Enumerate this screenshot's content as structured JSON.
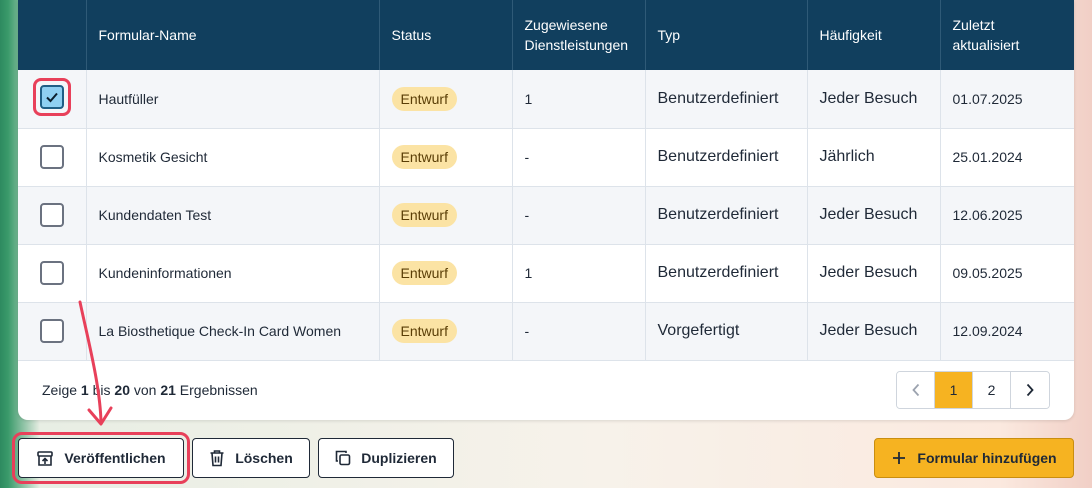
{
  "table": {
    "headers": [
      "",
      "Formular-Name",
      "Status",
      "Zugewiesene Dienstleistungen",
      "Typ",
      "Häufigkeit",
      "Zuletzt aktualisiert"
    ],
    "rows": [
      {
        "checked": true,
        "name": "Hautfüller",
        "status": "Entwurf",
        "services": "1",
        "type": "Benutzerdefiniert",
        "frequency": "Jeder Besuch",
        "updated": "01.07.2025"
      },
      {
        "checked": false,
        "name": "Kosmetik Gesicht",
        "status": "Entwurf",
        "services": "-",
        "type": "Benutzerdefiniert",
        "frequency": "Jährlich",
        "updated": "25.01.2024"
      },
      {
        "checked": false,
        "name": "Kundendaten Test",
        "status": "Entwurf",
        "services": "-",
        "type": "Benutzerdefiniert",
        "frequency": "Jeder Besuch",
        "updated": "12.06.2025"
      },
      {
        "checked": false,
        "name": "Kundeninformationen",
        "status": "Entwurf",
        "services": "1",
        "type": "Benutzerdefiniert",
        "frequency": "Jeder Besuch",
        "updated": "09.05.2025"
      },
      {
        "checked": false,
        "name": "La Biosthetique Check-In Card Women",
        "status": "Entwurf",
        "services": "-",
        "type": "Vorgefertigt",
        "frequency": "Jeder Besuch",
        "updated": "12.09.2024"
      }
    ]
  },
  "pagination": {
    "results_prefix": "Zeige ",
    "from": "1",
    "to_word": " bis ",
    "to": "20",
    "of_word": " von ",
    "total": "21",
    "suffix": " Ergebnissen",
    "prev_icon": "chevron-left-icon",
    "next_icon": "chevron-right-icon",
    "pages": [
      "1",
      "2"
    ],
    "current_page": "1"
  },
  "actions": {
    "publish_label": "Veröffentlichen",
    "delete_label": "Löschen",
    "duplicate_label": "Duplizieren",
    "add_label": "Formular hinzufügen"
  },
  "colors": {
    "header_bg": "#113f5e",
    "accent": "#f6b321",
    "highlight": "#e8405a",
    "badge_bg": "#fbe3a4"
  }
}
